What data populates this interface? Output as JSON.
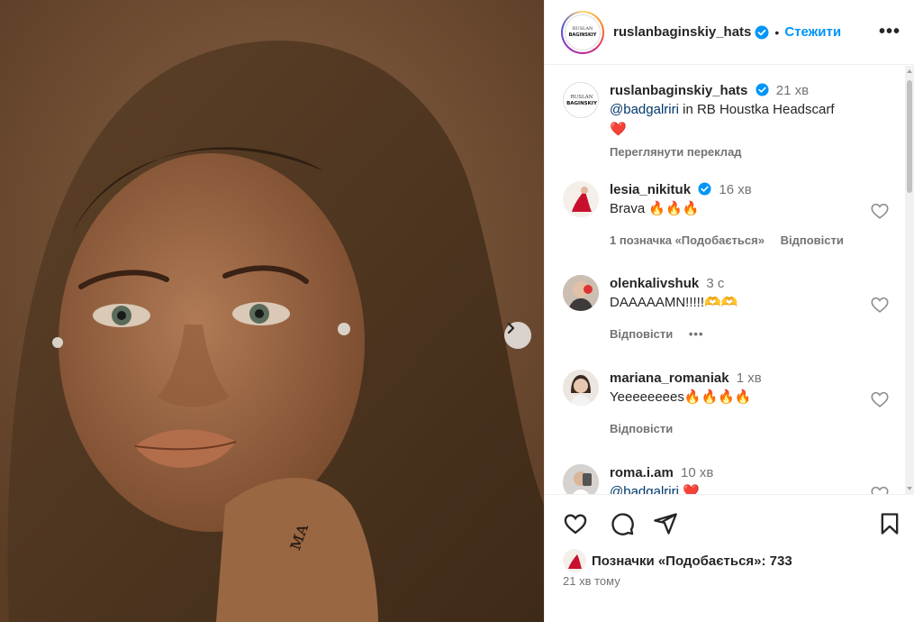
{
  "post": {
    "author": "ruslanbaginskiy_hats",
    "follow_label": "Стежити",
    "more_label": "•••",
    "logo_text": "RUSLAN BAGINSKIY"
  },
  "caption": {
    "username": "ruslanbaginskiy_hats",
    "time": "21 хв",
    "mention": "@badgalriri",
    "text": " in RB Houstka Headscarf",
    "emoji": "❤️",
    "translate_label": "Переглянути переклад"
  },
  "comments": [
    {
      "username": "lesia_nikituk",
      "verified": true,
      "time": "16 хв",
      "text": "Brava 🔥🔥🔥",
      "likes": "1 позначка «Подобається»",
      "reply": "Відповісти"
    },
    {
      "username": "olenkalivshuk",
      "verified": false,
      "time": "3 с",
      "text": "DAAAAAMN!!!!!🫶🫶",
      "reply": "Відповісти",
      "more": "•••"
    },
    {
      "username": "mariana_romaniak",
      "verified": false,
      "time": "1 хв",
      "text": "Yeeeeeeees🔥🔥🔥🔥",
      "reply": "Відповісти"
    },
    {
      "username": "roma.i.am",
      "verified": false,
      "time": "10 хв",
      "mention": "@badgalriri",
      "emoji": "❤️"
    }
  ],
  "footer": {
    "likes_label": "Позначки «Подобається»: 733",
    "posted_time": "21 хв тому"
  },
  "colors": {
    "accent": "#0095f6",
    "mention": "#00376b",
    "muted": "#737373"
  }
}
